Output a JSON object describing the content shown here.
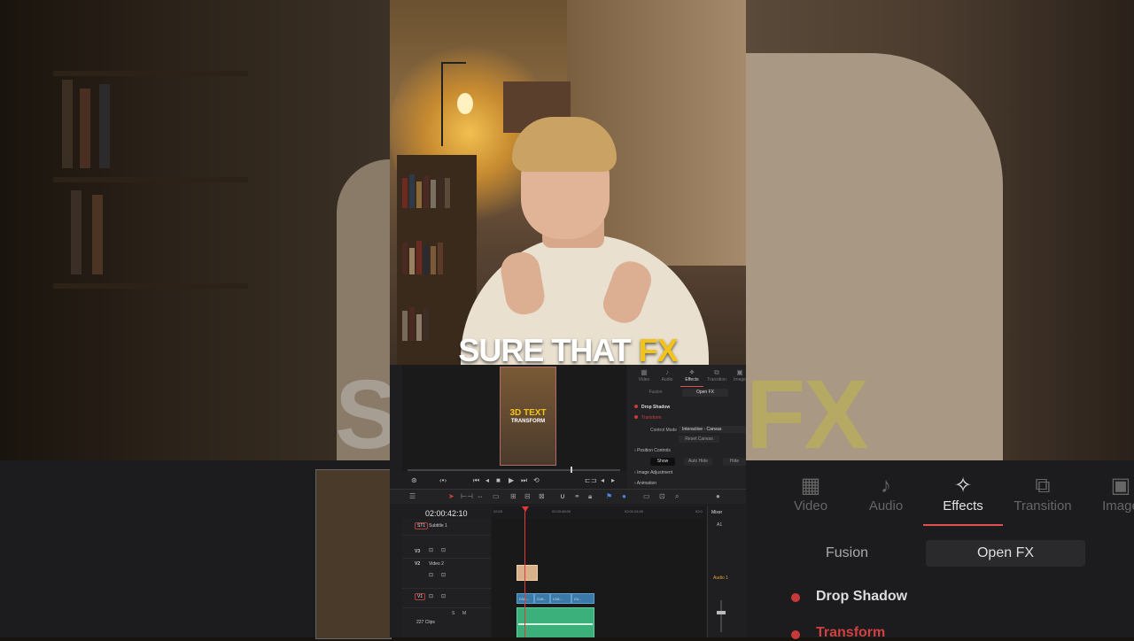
{
  "video": {
    "caption_main": "SURE THAT",
    "caption_highlight": "FX"
  },
  "background": {
    "ghost_left": "SU",
    "ghost_right": "FX",
    "big_tabs": [
      {
        "label": "Video",
        "icon": "film-icon"
      },
      {
        "label": "Audio",
        "icon": "music-note-icon"
      },
      {
        "label": "Effects",
        "icon": "magic-wand-icon",
        "active": true
      },
      {
        "label": "Transition",
        "icon": "transition-icon"
      },
      {
        "label": "Image",
        "icon": "image-icon"
      }
    ],
    "big_subtab_fusion": "Fusion",
    "big_subtab_openfx": "Open FX",
    "big_drop_shadow": "Drop Shadow",
    "big_transform": "Transform"
  },
  "thumbnail": {
    "title_line1": "3D TEXT",
    "title_line2": "TRANSFORM"
  },
  "inspector": {
    "tabs": [
      {
        "label": "Video",
        "icon": "film-icon"
      },
      {
        "label": "Audio",
        "icon": "music-note-icon"
      },
      {
        "label": "Effects",
        "icon": "magic-wand-icon",
        "active": true
      },
      {
        "label": "Transition",
        "icon": "transition-icon"
      },
      {
        "label": "Image",
        "icon": "image-icon"
      }
    ],
    "subtabs": {
      "fusion": "Fusion",
      "openfx": "Open FX"
    },
    "drop_shadow": "Drop Shadow",
    "transform": "Transform",
    "control_mode_label": "Control Mode",
    "control_mode_value": "Interactive - Canvas",
    "reset_canvas": "Reset Canvas",
    "position_controls": "Position Controls",
    "show": "Show",
    "auto_hide": "Auto Hide",
    "hide": "Hide",
    "image_adjustment": "Image Adjustment",
    "animation": "Animation"
  },
  "timeline": {
    "timecode": "02:00:42:10",
    "ruler": [
      "02:00",
      "02:00:48:00",
      "02:01:04:00",
      "02:0"
    ],
    "tracks": [
      {
        "id": "ST1",
        "name": "Subtitle 1"
      },
      {
        "id": "V3",
        "name": ""
      },
      {
        "id": "V2",
        "name": "Video 2"
      },
      {
        "id": "V1",
        "name": ""
      },
      {
        "id": "",
        "name": "227 Clips"
      }
    ],
    "video_clips": [
      "C10...",
      "C10...",
      "C10...",
      "C1..."
    ],
    "mixer_label": "Mixer",
    "mixer_channel": "A1",
    "mixer_audio": "Audio 1"
  },
  "colors": {
    "accent_red": "#e23a3a",
    "caption_yellow": "#f2c31a",
    "video_clip_blue": "#3b7aa8",
    "audio_clip_green": "#3cb07a"
  }
}
